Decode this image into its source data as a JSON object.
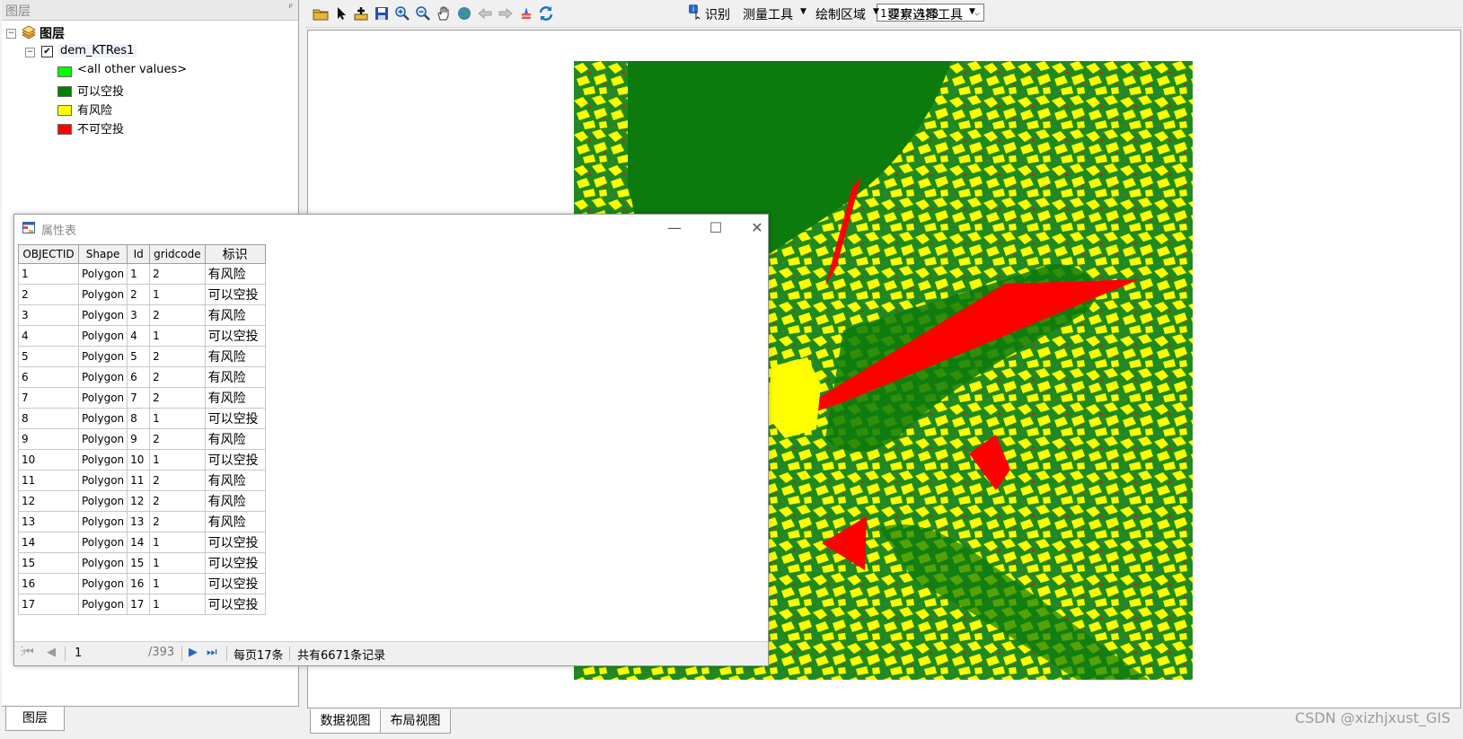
{
  "toc": {
    "header_title": "图层",
    "root_label": "图层",
    "layer_name": "dem_KTRes1",
    "legend": [
      {
        "label": "<all other values>",
        "color": "#00ff00"
      },
      {
        "label": "可以空投",
        "color": "#008000"
      },
      {
        "label": "有风险",
        "color": "#ffff00"
      },
      {
        "label": "不可空投",
        "color": "#ff0000"
      }
    ],
    "bottom_tab": "图层"
  },
  "toolbar": {
    "icons": [
      "open-folder-icon",
      "select-arrow-icon",
      "add-data-icon",
      "save-icon",
      "zoom-in-icon",
      "zoom-out-icon",
      "pan-hand-icon",
      "full-extent-globe-icon",
      "back-arrow-icon",
      "forward-arrow-icon",
      "clear-selection-icon",
      "refresh-icon"
    ],
    "scale": "1:217,138",
    "identify_label": "识别",
    "measure_label": "测量工具",
    "draw_area_label": "绘制区域",
    "feature_select_label": "要素选择工具"
  },
  "attribute_table": {
    "title": "属性表",
    "columns": [
      "OBJECTID",
      "Shape",
      "Id",
      "gridcode",
      "标识"
    ],
    "rows": [
      [
        "1",
        "Polygon",
        "1",
        "2",
        "有风险"
      ],
      [
        "2",
        "Polygon",
        "2",
        "1",
        "可以空投"
      ],
      [
        "3",
        "Polygon",
        "3",
        "2",
        "有风险"
      ],
      [
        "4",
        "Polygon",
        "4",
        "1",
        "可以空投"
      ],
      [
        "5",
        "Polygon",
        "5",
        "2",
        "有风险"
      ],
      [
        "6",
        "Polygon",
        "6",
        "2",
        "有风险"
      ],
      [
        "7",
        "Polygon",
        "7",
        "2",
        "有风险"
      ],
      [
        "8",
        "Polygon",
        "8",
        "1",
        "可以空投"
      ],
      [
        "9",
        "Polygon",
        "9",
        "2",
        "有风险"
      ],
      [
        "10",
        "Polygon",
        "10",
        "1",
        "可以空投"
      ],
      [
        "11",
        "Polygon",
        "11",
        "2",
        "有风险"
      ],
      [
        "12",
        "Polygon",
        "12",
        "2",
        "有风险"
      ],
      [
        "13",
        "Polygon",
        "13",
        "2",
        "有风险"
      ],
      [
        "14",
        "Polygon",
        "14",
        "1",
        "可以空投"
      ],
      [
        "15",
        "Polygon",
        "15",
        "1",
        "可以空投"
      ],
      [
        "16",
        "Polygon",
        "16",
        "1",
        "可以空投"
      ],
      [
        "17",
        "Polygon",
        "17",
        "1",
        "可以空投"
      ]
    ],
    "footer": {
      "current_page": "1",
      "total_pages": "/393",
      "per_page": "每页17条",
      "total_records": "共有6671条记录"
    }
  },
  "map_tabs": {
    "data_view": "数据视图",
    "layout_view": "布局视图"
  },
  "watermark": "CSDN @xizhjxust_GIS"
}
